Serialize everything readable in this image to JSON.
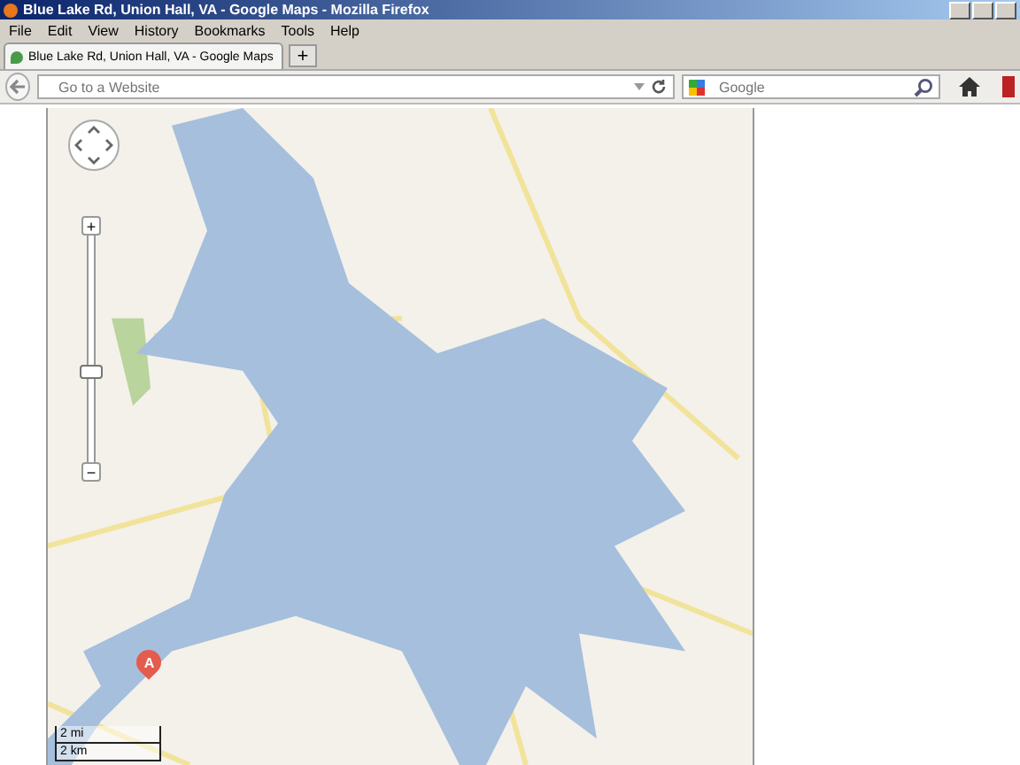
{
  "window": {
    "title": "Blue Lake Rd, Union Hall, VA - Google Maps - Mozilla Firefox"
  },
  "menu": [
    "File",
    "Edit",
    "View",
    "History",
    "Bookmarks",
    "Tools",
    "Help"
  ],
  "tabs": [
    {
      "label": "Blue Lake Rd, Union Hall, VA - Google Maps",
      "selected": true
    }
  ],
  "new_tab": "+",
  "address_bar": {
    "placeholder": "Go to a Website"
  },
  "search": {
    "placeholder": "Google"
  },
  "map": {
    "zoom": {
      "in": "+",
      "out": "−",
      "level": 0.37
    },
    "marker": "A",
    "scale": [
      "2 mi",
      "2 km"
    ]
  }
}
